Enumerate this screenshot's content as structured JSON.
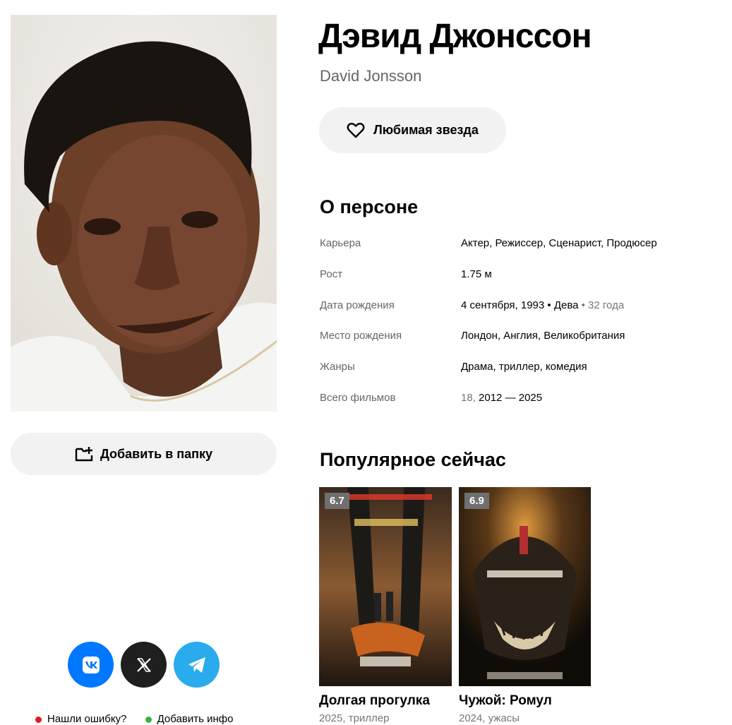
{
  "person": {
    "name": "Дэвид Джонссон",
    "original_name": "David Jonsson",
    "favorite_label": "Любимая звезда",
    "add_folder_label": "Добавить в папку"
  },
  "about": {
    "title": "О персоне",
    "rows": [
      {
        "label": "Карьера",
        "value": "Актер, Режиссер, Сценарист, Продюсер"
      },
      {
        "label": "Рост",
        "value": "1.75 м"
      },
      {
        "label": "Дата рождения",
        "value": "4 сентября, 1993",
        "sign": "• Дева",
        "age": "• 32 года"
      },
      {
        "label": "Место рождения",
        "value": "Лондон, Англия, Великобритания"
      },
      {
        "label": "Жанры",
        "value": "Драма, триллер, комедия"
      },
      {
        "label": "Всего фильмов",
        "count": "18,",
        "value": "2012 — 2025"
      }
    ]
  },
  "popular": {
    "title": "Популярное сейчас",
    "movies": [
      {
        "rating": "6.7",
        "title": "Долгая прогулка",
        "subtitle": "2025, триллер"
      },
      {
        "rating": "6.9",
        "title": "Чужой: Ромул",
        "subtitle": "2024, ужасы"
      }
    ]
  },
  "footer": {
    "report_error": "Нашли ошибку?",
    "add_info": "Добавить инфо"
  },
  "colors": {
    "vk": "#0077ff",
    "x": "#1f1f1f",
    "telegram": "#2aabee",
    "error_dot": "#e11a1a",
    "info_dot": "#3bb33b"
  }
}
